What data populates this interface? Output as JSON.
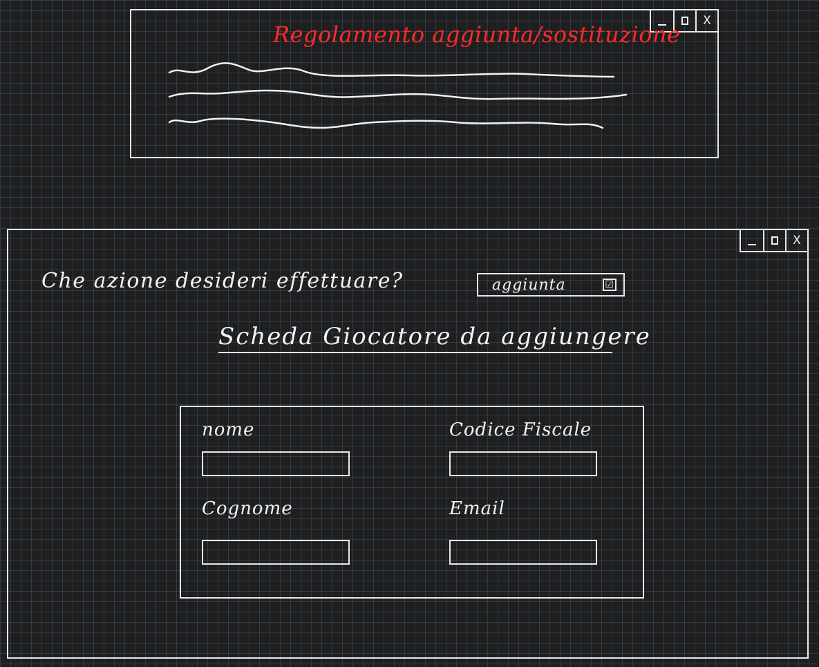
{
  "rules_window": {
    "title": "Regolamento aggiunta/sostituzione",
    "controls": {
      "minimize": "",
      "maximize": "",
      "close": "X"
    }
  },
  "main_window": {
    "controls": {
      "minimize": "",
      "maximize": "",
      "close": "X"
    },
    "question": "Che azione desideri effettuare?",
    "action_select": {
      "value": "aggiunta",
      "check_icon": "☑"
    },
    "card_title": "Scheda Giocatore da aggiungere",
    "form": {
      "nome_label": "nome",
      "nome_value": "",
      "cognome_label": "Cognome",
      "cognome_value": "",
      "codice_fiscale_label": "Codice Fiscale",
      "codice_fiscale_value": "",
      "email_label": "Email",
      "email_value": ""
    }
  },
  "colors": {
    "background": "#1f1f1f",
    "grid": "#466e96",
    "ink": "#f2f2f2",
    "accent_red": "#ff2a2a"
  }
}
